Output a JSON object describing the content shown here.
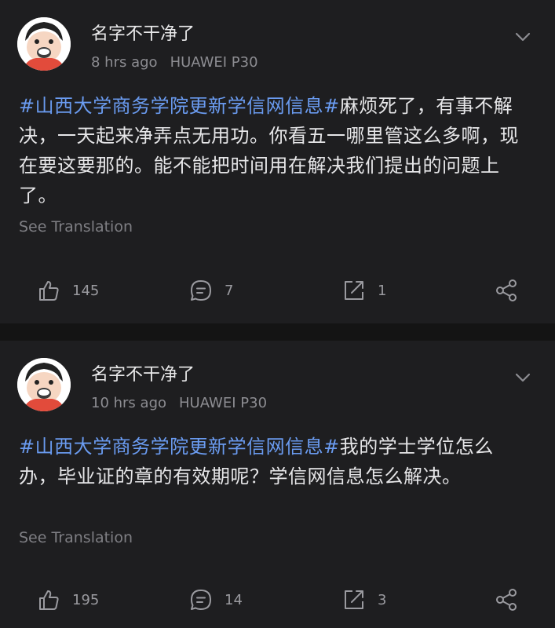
{
  "posts": [
    {
      "username": "名字不干净了",
      "time": "8 hrs ago",
      "device": "HUAWEI P30",
      "hashtag": "#山西大学商务学院更新学信网信息#",
      "text": "麻烦死了，有事不解决，一天起来净弄点无用功。你看五一哪里管这么多啊，现在要这要那的。能不能把时间用在解决我们提出的问题上了。",
      "see_translation": "See Translation",
      "likes": "145",
      "comments": "7",
      "reposts": "1"
    },
    {
      "username": "名字不干净了",
      "time": "10 hrs ago",
      "device": "HUAWEI P30",
      "hashtag": "#山西大学商务学院更新学信网信息#",
      "text": "我的学士学位怎么办，毕业证的章的有效期呢？学信网信息怎么解决。",
      "see_translation": "See Translation",
      "likes": "195",
      "comments": "14",
      "reposts": "3"
    }
  ],
  "colors": {
    "background": "#1e1e20",
    "separator": "#141414",
    "hashtag": "#6a9bf0",
    "text": "#e6e6e8",
    "muted": "#8d8d92"
  },
  "icons": [
    "avatar",
    "chevron-down-icon",
    "thumbs-up-icon",
    "comment-icon",
    "repost-icon",
    "share-icon"
  ]
}
